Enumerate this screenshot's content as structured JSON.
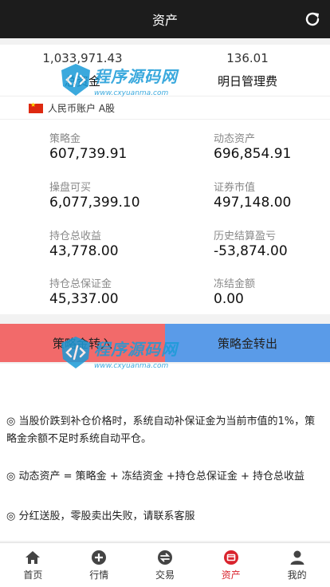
{
  "header": {
    "title": "资产"
  },
  "summary": {
    "left": {
      "value": "1,033,971.43",
      "label": "总资金"
    },
    "right": {
      "value": "136.01",
      "label": "明日管理费"
    }
  },
  "account": {
    "label": "人民币账户 A股"
  },
  "metrics": [
    {
      "label": "策略金",
      "value": "607,739.91"
    },
    {
      "label": "动态资产",
      "value": "696,854.91"
    },
    {
      "label": "操盘可买",
      "value": "6,077,399.10"
    },
    {
      "label": "证券市值",
      "value": "497,148.00"
    },
    {
      "label": "持仓总收益",
      "value": "43,778.00"
    },
    {
      "label": "历史结算盈亏",
      "value": "-53,874.00"
    },
    {
      "label": "持仓总保证金",
      "value": "45,337.00"
    },
    {
      "label": "冻结金额",
      "value": "0.00"
    }
  ],
  "actions": {
    "transfer_in": "策略金转入",
    "transfer_out": "策略金转出"
  },
  "notes": [
    "◎ 当股价跌到补仓价格时，系统自动补保证金为当前市值的1%，策略金余额不足时系统自动平仓。",
    "◎ 动态资产 = 策略金 + 冻结资金 +持仓总保证金 + 持仓总收益",
    "◎ 分红送股，零股卖出失败，请联系客服"
  ],
  "watermark": {
    "text": "程序源码网",
    "url": "www.cxyuanma.com"
  },
  "tabs": [
    {
      "label": "首页",
      "icon": "home-icon"
    },
    {
      "label": "行情",
      "icon": "plus-circle-icon"
    },
    {
      "label": "交易",
      "icon": "exchange-icon"
    },
    {
      "label": "资产",
      "icon": "wallet-icon",
      "active": true
    },
    {
      "label": "我的",
      "icon": "user-icon"
    }
  ],
  "colors": {
    "header_bg": "#1c1c1c",
    "transfer_in_bg": "#f26a6a",
    "transfer_out_bg": "#5a9be8",
    "active_tab": "#d9232d",
    "watermark": "#1a9bd8"
  }
}
